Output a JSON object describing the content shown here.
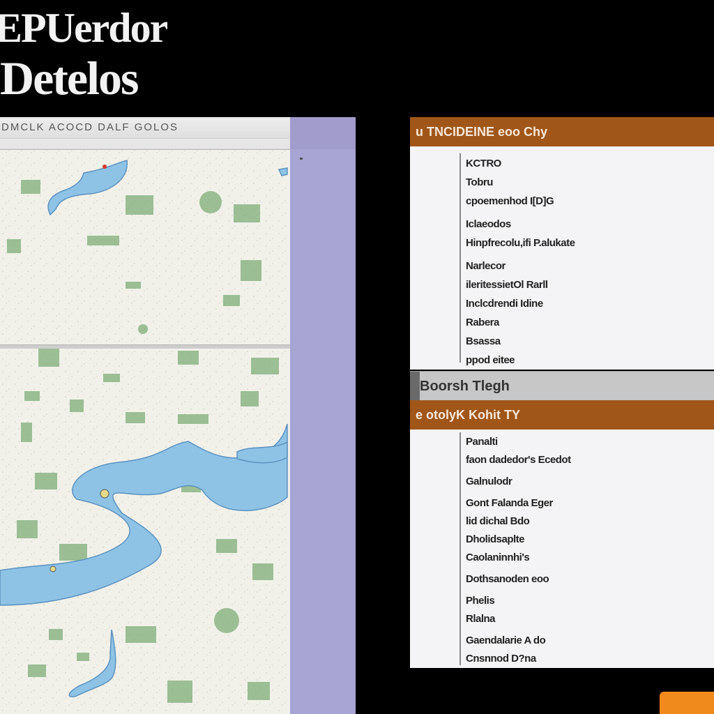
{
  "title": {
    "line1": "EPUerdor",
    "line2": "Detelos"
  },
  "map": {
    "toolbar_text": "DMCLK ACOCD DALF GOLOS",
    "colors": {
      "land": "#f1f1ea",
      "water": "#8ec3e6",
      "parcel": "#6fa46a"
    }
  },
  "panel1": {
    "header": "u TNCIDEINE eoo Chy",
    "items": [
      "KCTRO",
      "Tobru",
      "cpoemenhod I[D]G",
      "Iclaeodos",
      "Hinpfrecolu,ifi P.alukate",
      "Narlecor",
      "ileritessietOl Rarll",
      "Inclcdrendi Idine",
      "Rabera",
      "Bsassa",
      "ppod eitee"
    ]
  },
  "section_bar": {
    "label": "Boorsh Tlegh"
  },
  "panel2": {
    "header": "e otolyK Kohit TY",
    "items": [
      "Panalti",
      "faon dadedor's Ecedot",
      "Galnulodr",
      "Gont Falanda Eger",
      "lid dichal Bdo",
      "Dholidsaplte",
      "Caolaninnhi's",
      "Dothsanoden eoo",
      "Phelis",
      "Rlalna",
      "Gaendalarie A do",
      "Cnsnnod D?na"
    ]
  },
  "accent_color": "#a05618",
  "button_color": "#f08a1c"
}
